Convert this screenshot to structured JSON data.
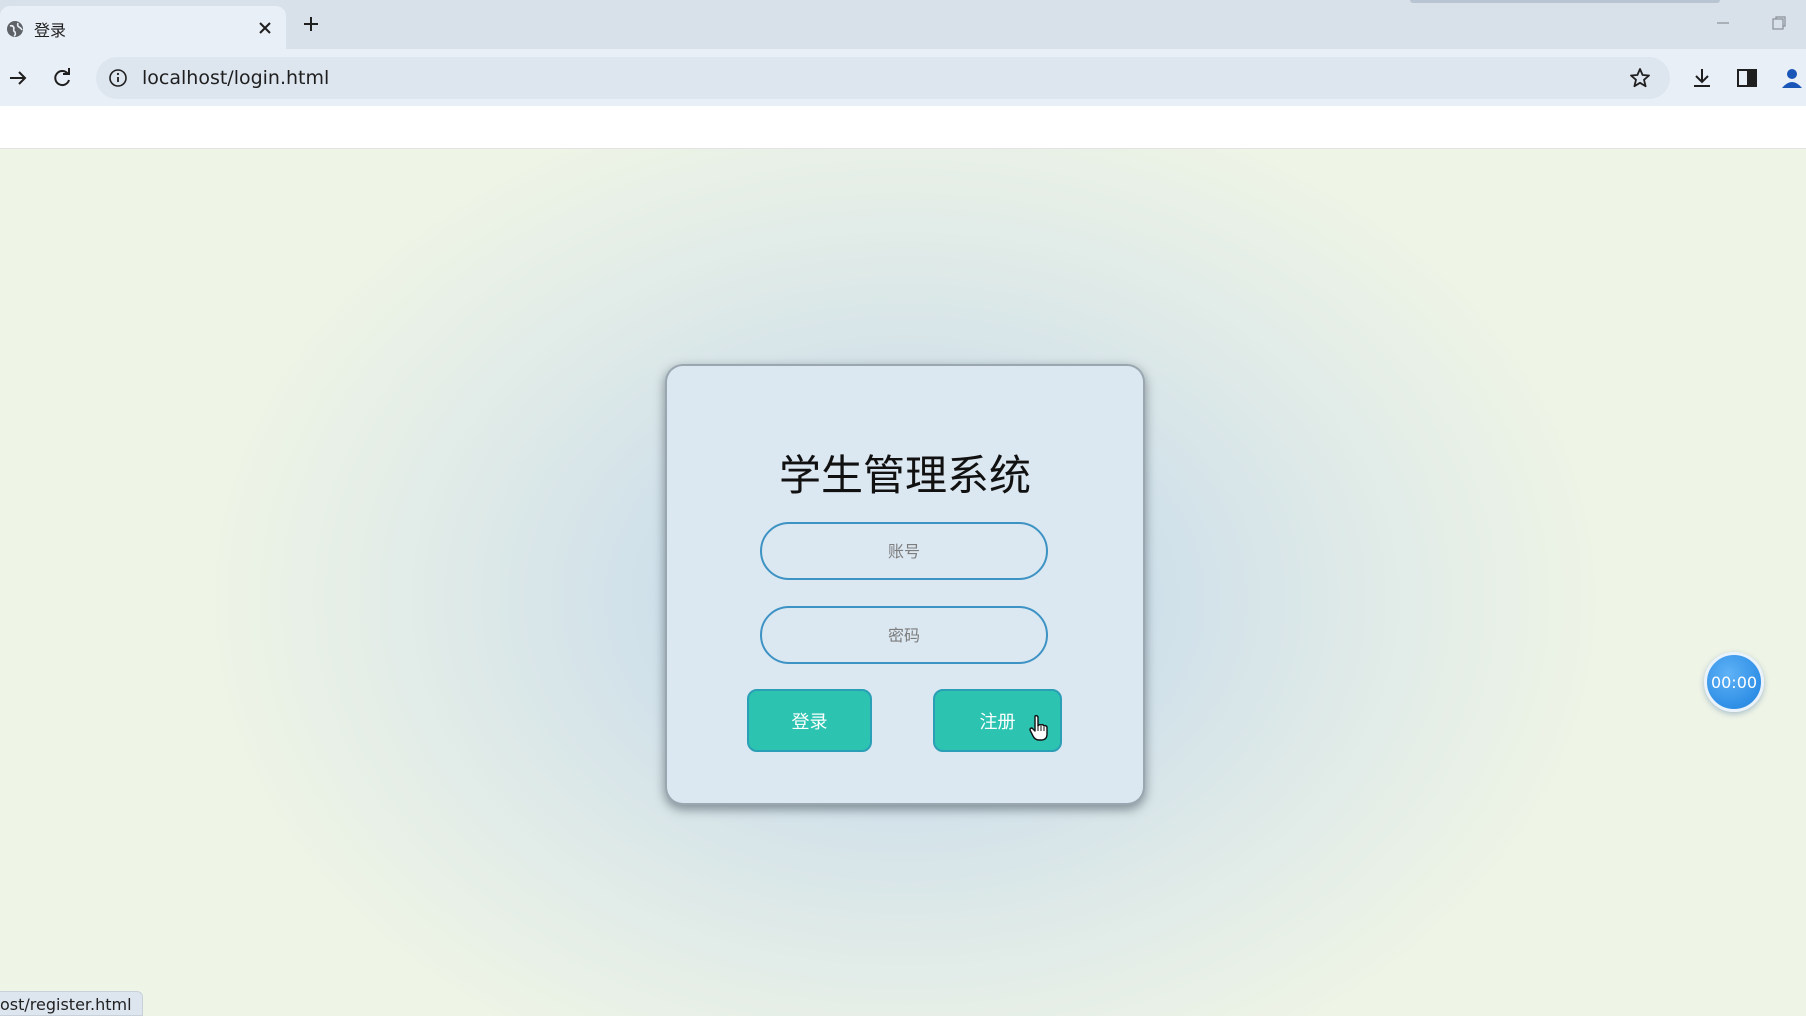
{
  "browser": {
    "tab": {
      "title": "登录",
      "favicon": "globe-icon",
      "close_icon": "close-icon"
    },
    "new_tab_icon": "plus-icon",
    "window_controls": [
      "minimize-icon",
      "restore-icon"
    ],
    "toolbar": {
      "forward_icon": "arrow-right-icon",
      "reload_icon": "reload-icon",
      "site_info_icon": "info-icon",
      "url": "localhost/login.html",
      "bookmark_icon": "star-icon",
      "download_icon": "download-icon",
      "side_panel_icon": "side-panel-icon",
      "profile_icon": "profile-icon"
    }
  },
  "login": {
    "title": "学生管理系统",
    "account_placeholder": "账号",
    "password_placeholder": "密码",
    "login_label": "登录",
    "register_label": "注册"
  },
  "timer": {
    "text": "00:00"
  },
  "status_bar": {
    "text": "ost/register.html"
  },
  "colors": {
    "button_bg": "#2dc3b1",
    "input_border": "#3d93c4",
    "timer_bg": "#2f8fe6",
    "card_bg": "#dbe7f1"
  }
}
